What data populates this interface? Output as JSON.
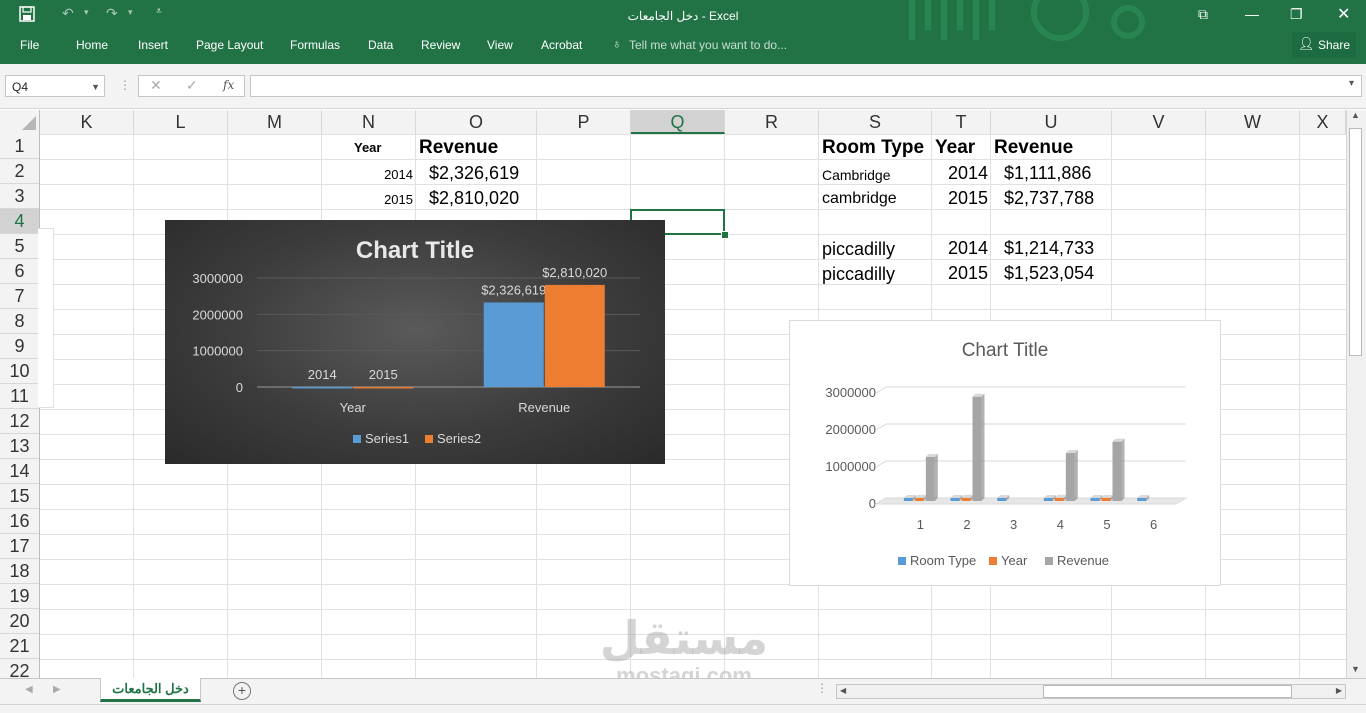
{
  "window": {
    "title": "دخل الجامعات - Excel",
    "share_label": "Share",
    "tell_me": "Tell me what you want to do...",
    "tabs": [
      "File",
      "Home",
      "Insert",
      "Page Layout",
      "Formulas",
      "Data",
      "Review",
      "View",
      "Acrobat"
    ]
  },
  "formula_bar": {
    "name_box": "Q4",
    "formula": ""
  },
  "columns": [
    "K",
    "L",
    "M",
    "N",
    "O",
    "P",
    "Q",
    "R",
    "S",
    "T",
    "U",
    "V",
    "W",
    "X"
  ],
  "selected_column": "Q",
  "rows": [
    "1",
    "2",
    "3",
    "4",
    "5",
    "6",
    "7",
    "8",
    "9",
    "10",
    "11",
    "12",
    "13",
    "14",
    "15",
    "16",
    "17",
    "18",
    "19",
    "20",
    "21",
    "22"
  ],
  "selected_row": "4",
  "cells": {
    "N1": "Year",
    "O1": "Revenue",
    "N2": "2014",
    "O2": "$2,326,619",
    "N3": "2015",
    "O3": "$2,810,020",
    "S1": "Room Type",
    "T1": "Year",
    "U1": "Revenue",
    "S2": "Cambridge",
    "T2": "2014",
    "U2": "$1,111,886",
    "S3": "cambridge",
    "T3": "2015",
    "U3": "$2,737,788",
    "S5": "piccadilly",
    "T5": "2014",
    "U5": "$1,214,733",
    "S6": "piccadilly",
    "T6": "2015",
    "U6": "$1,523,054"
  },
  "sheet_tab": "دخل الجامعات",
  "watermark": {
    "arabic": "مستقل",
    "latin": "mostaqi.com"
  },
  "chart_data": [
    {
      "type": "bar",
      "title": "Chart Title",
      "categories": [
        "Year",
        "Revenue"
      ],
      "series": [
        {
          "name": "Series1",
          "values": [
            2014,
            2326619
          ],
          "data_labels": [
            "2014",
            "$2,326,619"
          ],
          "color": "#5b9bd5"
        },
        {
          "name": "Series2",
          "values": [
            2015,
            2810020
          ],
          "data_labels": [
            "2015",
            "$2,810,020"
          ],
          "color": "#ed7d31"
        }
      ],
      "yticks": [
        "0",
        "1000000",
        "2000000",
        "3000000"
      ],
      "ylim": [
        0,
        3000000
      ],
      "legend": "bottom",
      "grid": true
    },
    {
      "type": "bar",
      "title": "Chart Title",
      "categories": [
        "1",
        "2",
        "3",
        "4",
        "5",
        "6"
      ],
      "series": [
        {
          "name": "Room Type",
          "values": [
            0,
            0,
            0,
            0,
            0,
            0
          ],
          "color": "#5b9bd5"
        },
        {
          "name": "Year",
          "values": [
            2014,
            2015,
            0,
            2014,
            2015,
            0
          ],
          "color": "#ed7d31"
        },
        {
          "name": "Revenue",
          "values": [
            1111886,
            2737788,
            0,
            1214733,
            1523054,
            0
          ],
          "color": "#a5a5a5"
        }
      ],
      "yticks": [
        "0",
        "1000000",
        "2000000",
        "3000000"
      ],
      "ylim": [
        0,
        3000000
      ],
      "legend": "bottom",
      "grid": true
    }
  ]
}
